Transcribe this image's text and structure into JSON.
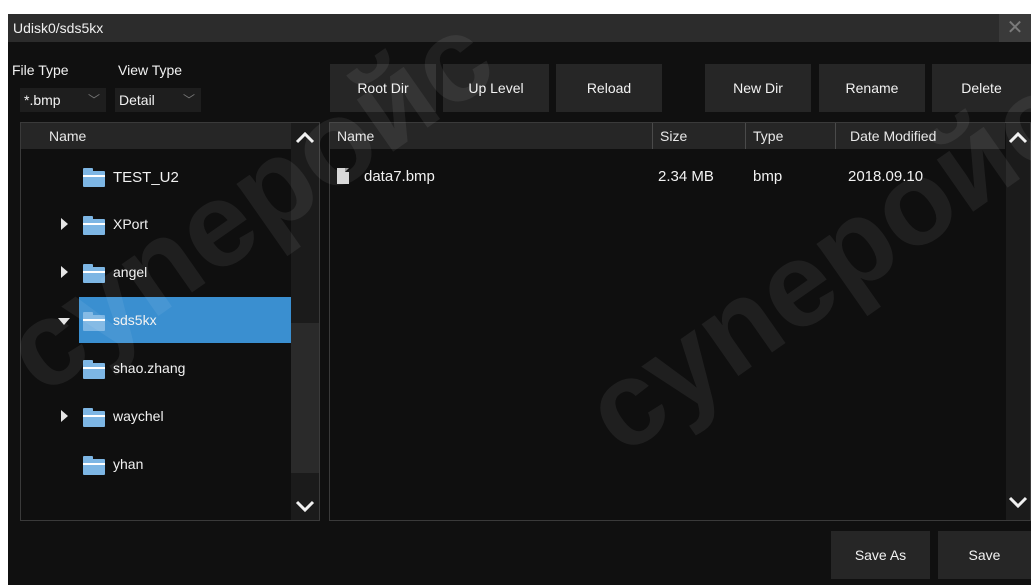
{
  "window": {
    "title": "Udisk0/sds5kx",
    "close_glyph": "✕"
  },
  "filters": {
    "file_type_label": "File Type",
    "view_type_label": "View Type",
    "file_type_value": "*.bmp",
    "view_type_value": "Detail"
  },
  "toolbar": {
    "root_dir": "Root Dir",
    "up_level": "Up Level",
    "reload": "Reload",
    "new_dir": "New Dir",
    "rename": "Rename",
    "delete": "Delete"
  },
  "tree": {
    "header": "Name",
    "items": [
      {
        "label": "TEST_U2",
        "expandable": false,
        "expanded": false,
        "selected": false
      },
      {
        "label": "XPort",
        "expandable": true,
        "expanded": false,
        "selected": false
      },
      {
        "label": "angel",
        "expandable": true,
        "expanded": false,
        "selected": false
      },
      {
        "label": "sds5kx",
        "expandable": true,
        "expanded": true,
        "selected": true
      },
      {
        "label": "shao.zhang",
        "expandable": false,
        "expanded": false,
        "selected": false
      },
      {
        "label": "waychel",
        "expandable": true,
        "expanded": false,
        "selected": false
      },
      {
        "label": "yhan",
        "expandable": false,
        "expanded": false,
        "selected": false
      }
    ]
  },
  "files": {
    "columns": {
      "name": "Name",
      "size": "Size",
      "type": "Type",
      "date": "Date Modified"
    },
    "rows": [
      {
        "name": "data7.bmp",
        "size": "2.34 MB",
        "type": "bmp",
        "date": "2018.09.10"
      }
    ]
  },
  "footer": {
    "save_as": "Save As",
    "save": "Save"
  },
  "watermark": {
    "text": "cynepoйс"
  },
  "colors": {
    "selection": "#3a8fd0",
    "folder": "#7db6e4",
    "background": "#101010"
  }
}
